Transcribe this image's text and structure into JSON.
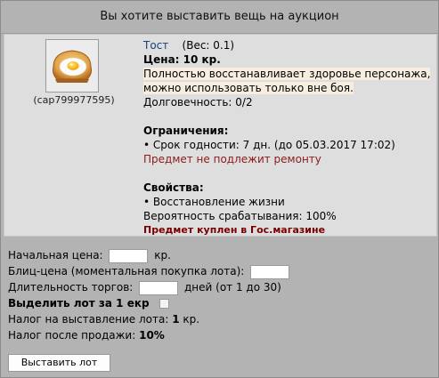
{
  "dialog": {
    "title": "Вы хотите выставить вещь на аукцион"
  },
  "item": {
    "image_icon": "toast-egg-icon",
    "owner": "(cap799977595)",
    "name": "Тост",
    "weight": "(Вес: 0.1)",
    "price": "Цена: 10 кр.",
    "description_line1": "Полностью восстанавливает здоровье персонажа,",
    "description_line2": "можно использовать только вне боя.",
    "durability": "Долговечность: 0/2",
    "restrictions_title": "Ограничения:",
    "expiry": "• Срок годности: 7 дн. (до 05.03.2017 17:02)",
    "not_repairable": "Предмет не подлежит ремонту",
    "properties_title": "Свойства:",
    "property_1": "• Восстановление жизни",
    "trigger_chance": "Вероятность срабатывания: 100%",
    "bought_in": "Предмет куплен в Гос.магазине"
  },
  "form": {
    "start_price_label": "Начальная цена:",
    "start_price_value": "",
    "start_price_unit": "кр.",
    "blitz_label": "Блиц-цена (моментальная покупка лота):",
    "blitz_value": "",
    "duration_label": "Длительность торгов:",
    "duration_value": "",
    "duration_hint": "дней (от 1 до 30)",
    "highlight_label": "Выделить лот за 1 екр",
    "highlight_checked": false,
    "listing_tax_label": "Налог на выставление лота:",
    "listing_tax_value": "1",
    "listing_tax_unit": "кр.",
    "sale_tax_label": "Налог после продажи:",
    "sale_tax_value": "10%",
    "submit_label": "Выставить лот"
  },
  "colors": {
    "background": "#b3b3b3",
    "panel": "#dedede",
    "item_name": "#1f3f7a",
    "warning": "#8b1a1a"
  }
}
